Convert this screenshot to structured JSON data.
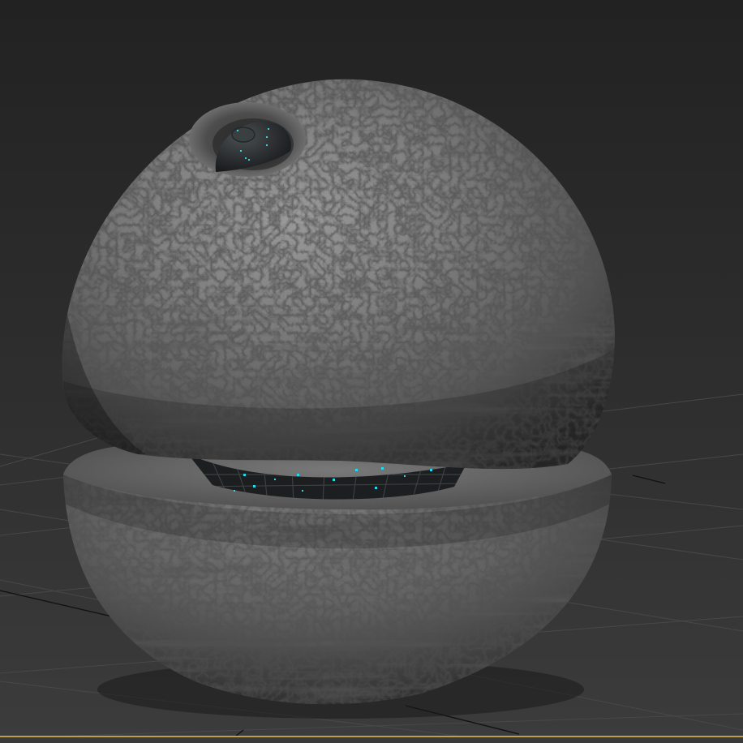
{
  "viewport": {
    "label": "3D viewport",
    "object": "rock-pod-mesh",
    "colors": {
      "background_top": "#232323",
      "background_bottom": "#3a3a3a",
      "grid_line": "#4a4a4a",
      "grid_axis": "#111111",
      "rock_light": "#8c8c8c",
      "rock_dark": "#2e2e2e",
      "glow_accent": "#2fd6e8",
      "viewport_border": "#b8a050"
    }
  }
}
